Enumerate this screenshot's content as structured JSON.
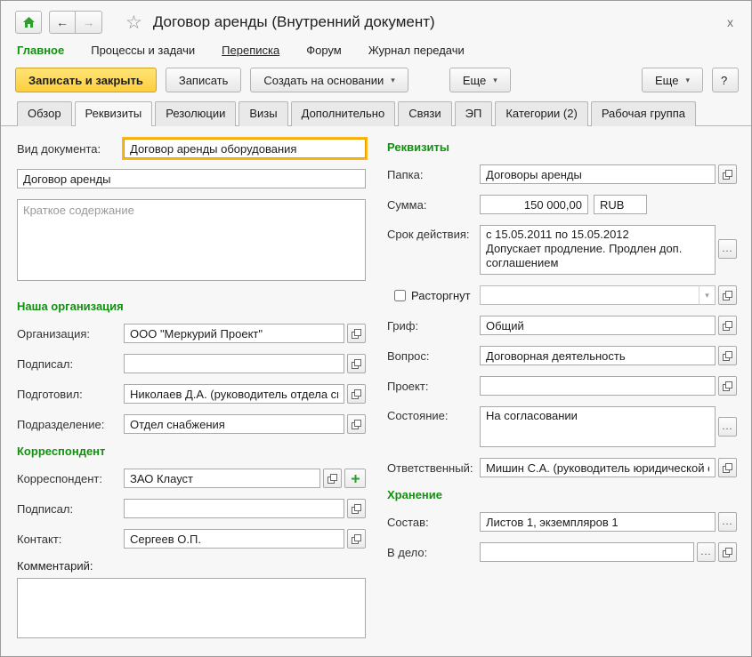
{
  "window": {
    "title": "Договор аренды (Внутренний документ)",
    "close": "x"
  },
  "nav": {
    "items": [
      "Главное",
      "Процессы и задачи",
      "Переписка",
      "Форум",
      "Журнал передачи"
    ]
  },
  "toolbar": {
    "save_close": "Записать и закрыть",
    "save": "Записать",
    "create_based": "Создать на основании",
    "more_form": "Еще",
    "more_window": "Еще",
    "help": "?"
  },
  "tabs": [
    "Обзор",
    "Реквизиты",
    "Резолюции",
    "Визы",
    "Дополнительно",
    "Связи",
    "ЭП",
    "Категории (2)",
    "Рабочая группа"
  ],
  "form": {
    "left": {
      "doc_type": {
        "label": "Вид документа:",
        "value": "Договор аренды оборудования"
      },
      "name": {
        "value": "Договор аренды"
      },
      "summary": {
        "placeholder": "Краткое содержание"
      },
      "org_section": "Наша организация",
      "organization": {
        "label": "Организация:",
        "value": "ООО \"Меркурий Проект\""
      },
      "signed_by": {
        "label": "Подписал:",
        "value": ""
      },
      "prepared_by": {
        "label": "Подготовил:",
        "value": "Николаев Д.А. (руководитель отдела сн"
      },
      "department": {
        "label": "Подразделение:",
        "value": "Отдел снабжения"
      },
      "corr_section": "Корреспондент",
      "correspondent": {
        "label": "Корреспондент:",
        "value": "ЗАО Клауст"
      },
      "corr_signed_by": {
        "label": "Подписал:",
        "value": ""
      },
      "contact": {
        "label": "Контакт:",
        "value": "Сергеев О.П."
      },
      "comment": {
        "label": "Комментарий:",
        "value": ""
      }
    },
    "right": {
      "section": "Реквизиты",
      "folder": {
        "label": "Папка:",
        "value": "Договоры аренды"
      },
      "amount": {
        "label": "Сумма:",
        "value": "150 000,00",
        "currency": "RUB"
      },
      "validity": {
        "label": "Срок действия:",
        "value": "с 15.05.2011 по 15.05.2012\nДопускает продление. Продлен доп.\nсоглашением"
      },
      "terminated": {
        "label": "Расторгнут",
        "value": ""
      },
      "stamp": {
        "label": "Гриф:",
        "value": "Общий"
      },
      "question": {
        "label": "Вопрос:",
        "value": "Договорная деятельность"
      },
      "project": {
        "label": "Проект:",
        "value": ""
      },
      "state": {
        "label": "Состояние:",
        "value": "На согласовании"
      },
      "responsible": {
        "label": "Ответственный:",
        "value": "Мишин С.А. (руководитель юридической с"
      },
      "storage_section": "Хранение",
      "composition": {
        "label": "Состав:",
        "value": "Листов 1, экземпляров 1"
      },
      "to_file": {
        "label": "В дело:",
        "value": ""
      }
    }
  },
  "misc": {
    "ellipsis": "...",
    "caret": "▾"
  },
  "colors": {
    "accent_green": "#11920f",
    "save_button_yellow": "#fdce3e",
    "focus_border": "#fdb814"
  }
}
